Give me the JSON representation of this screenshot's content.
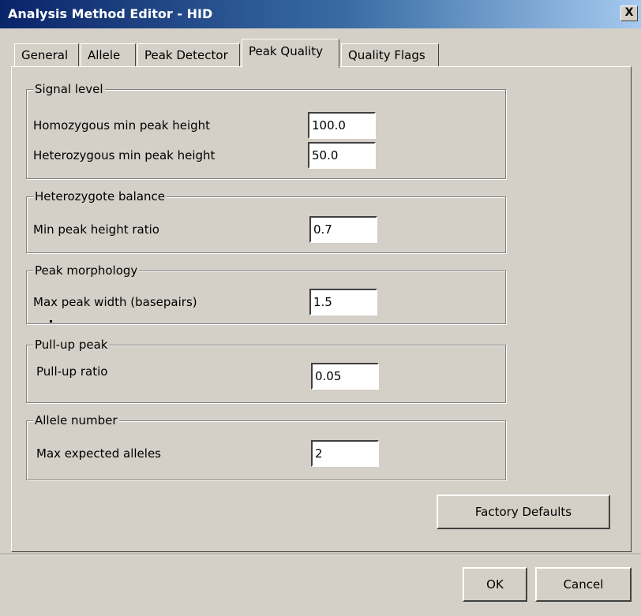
{
  "window": {
    "title": "Analysis Method Editor - HID",
    "close_glyph": "X"
  },
  "tabs": [
    {
      "label": "General"
    },
    {
      "label": "Allele"
    },
    {
      "label": "Peak Detector"
    },
    {
      "label": "Peak Quality",
      "active": true
    },
    {
      "label": "Quality Flags"
    }
  ],
  "groups": {
    "signal_level": {
      "title": "Signal level",
      "rows": [
        {
          "label": "Homozygous min peak height",
          "value": "100.0"
        },
        {
          "label": "Heterozygous min peak height",
          "value": "50.0"
        }
      ]
    },
    "heterozygote_balance": {
      "title": "Heterozygote balance",
      "rows": [
        {
          "label": "Min peak height ratio",
          "value": "0.7"
        }
      ]
    },
    "peak_morphology": {
      "title": "Peak morphology",
      "rows": [
        {
          "label": "Max peak width (basepairs)",
          "value": "1.5"
        }
      ]
    },
    "pull_up_peak": {
      "title": "Pull-up peak",
      "rows": [
        {
          "label": "Pull-up ratio",
          "value": "0.05"
        }
      ]
    },
    "allele_number": {
      "title": "Allele number",
      "rows": [
        {
          "label": "Max expected alleles",
          "value": "2"
        }
      ]
    }
  },
  "buttons": {
    "factory_defaults": "Factory Defaults",
    "ok": "OK",
    "cancel": "Cancel"
  }
}
